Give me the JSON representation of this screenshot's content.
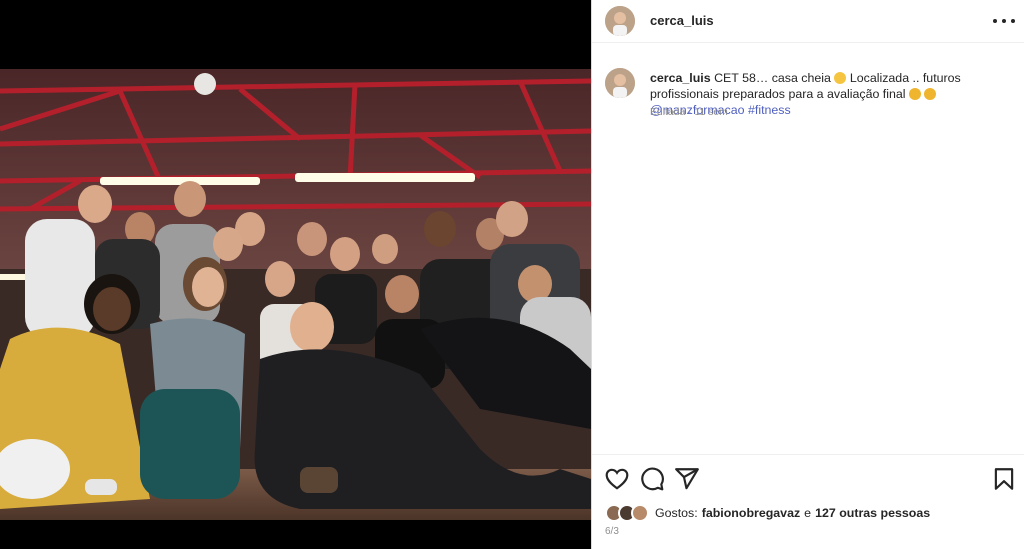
{
  "post": {
    "username": "cerca_luis",
    "more_icon": "more-horizontal-icon"
  },
  "caption": {
    "username": "cerca_luis",
    "text_part1": "CET 58… casa cheia",
    "text_part2": "Localizada .. futuros profissionais preparados para a avaliação final",
    "mention": "@manzformacao",
    "hashtag": "#fitness",
    "edited_label": "Editada",
    "separator": "·",
    "time_ago": "11 sem",
    "emojis": [
      "smiling-face-emoji",
      "flexed-biceps-emoji",
      "flexed-biceps-emoji"
    ]
  },
  "actions": {
    "like_icon": "heart-icon",
    "comment_icon": "comment-bubble-icon",
    "share_icon": "paper-plane-icon",
    "save_icon": "bookmark-icon"
  },
  "likes": {
    "label": "Gostos:",
    "first_user": "fabionobregavaz",
    "conjunction": "e",
    "others": "127 outras pessoas"
  },
  "date": "6/3",
  "colors": {
    "link": "#4f5fbf",
    "text": "#262626",
    "muted": "#8e8e8e",
    "border": "#dbdbdb"
  }
}
